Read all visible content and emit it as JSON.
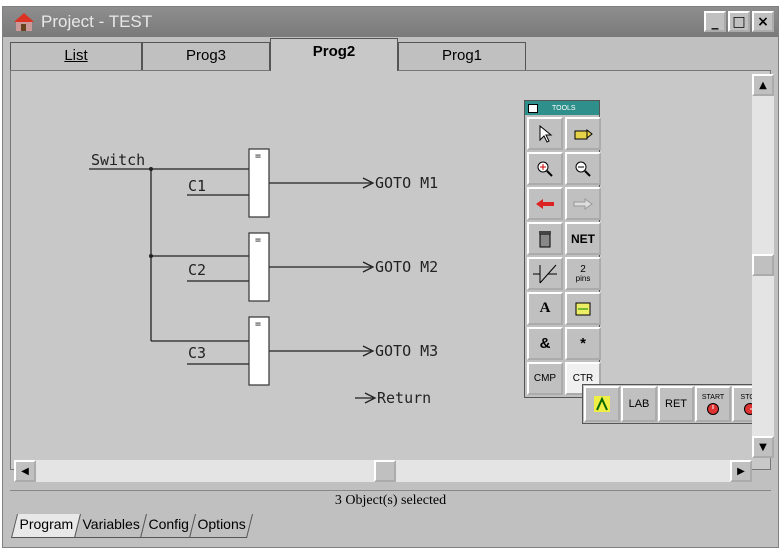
{
  "window": {
    "title": "Project - TEST"
  },
  "titlebar_buttons": {
    "minimize": "_",
    "maximize": "□",
    "close": "×"
  },
  "tabs_top": [
    "List",
    "Prog3",
    "Prog2",
    "Prog1"
  ],
  "active_tab": "Prog2",
  "diagram": {
    "input_label": "Switch",
    "conditions": [
      "C1",
      "C2",
      "C3"
    ],
    "block_symbol": "=",
    "gotos": [
      "GOTO M1",
      "GOTO M2",
      "GOTO M3"
    ],
    "return_label": "Return"
  },
  "toolbox": {
    "title": "TOOLS",
    "buttons": [
      "pointer",
      "hand",
      "zoom-in",
      "zoom-out",
      "arrow-left",
      "arrow-right-disabled",
      "trash",
      "NET",
      "contact",
      "2 pins",
      "A",
      "wire-edit",
      "&",
      "*",
      "CMP",
      "CTR"
    ],
    "net_label": "NET",
    "pins_top": "2",
    "pins_bottom": "pins",
    "a_label": "A",
    "and_label": "&",
    "star_label": "*",
    "cmp_label": "CMP",
    "ctr_label": "CTR"
  },
  "toolbox2": {
    "lab": "LAB",
    "ret": "RET",
    "start": "START",
    "stop": "STOP"
  },
  "scroll": {
    "up": "▲",
    "down": "▼",
    "left": "◀",
    "right": "▶"
  },
  "status": "3 Object(s) selected",
  "bottom_tabs": [
    "Program",
    "Variables",
    "Config",
    "Options"
  ]
}
